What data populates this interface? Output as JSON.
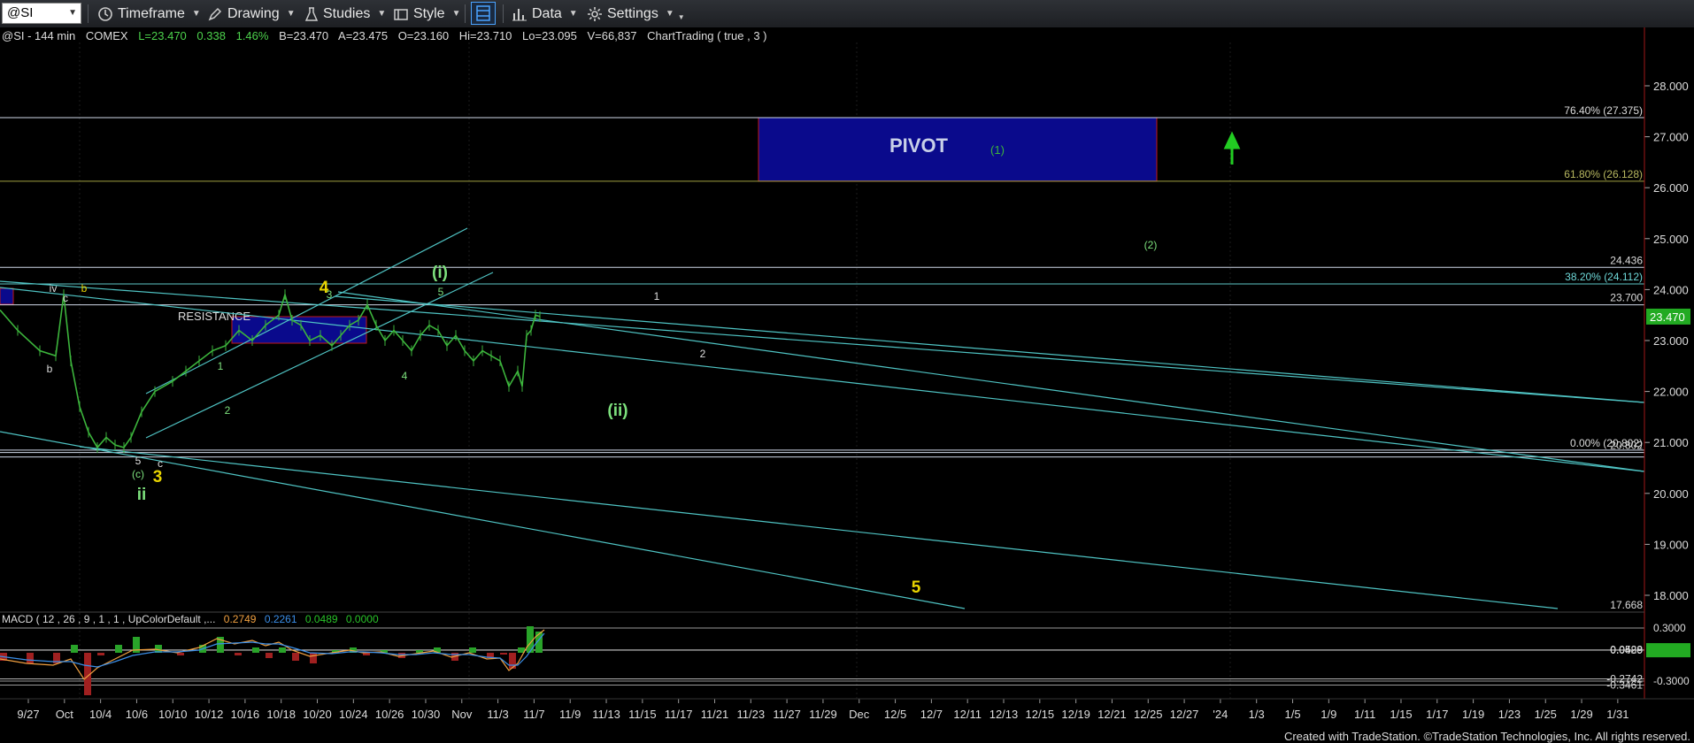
{
  "toolbar": {
    "symbol": "@SI",
    "timeframe": "Timeframe",
    "drawing": "Drawing",
    "studies": "Studies",
    "style": "Style",
    "data": "Data",
    "settings": "Settings"
  },
  "header": {
    "symbol": "@SI - 144 min",
    "exchange": "COMEX",
    "last": "L=23.470",
    "change": "0.338",
    "change_pct": "1.46%",
    "bid": "B=23.470",
    "ask": "A=23.475",
    "open": "O=23.160",
    "high": "Hi=23.710",
    "low": "Lo=23.095",
    "volume": "V=66,837",
    "study": "ChartTrading ( true , 3 )"
  },
  "macd_header": {
    "label": "MACD ( 12 , 26 , 9 , 1 , 1 , UpColorDefault ,...",
    "v1": "0.2749",
    "v2": "0.2261",
    "v3": "0.0489",
    "v4": "0.0000"
  },
  "footer": "Created with TradeStation. ©TradeStation Technologies, Inc. All rights reserved.",
  "colors": {
    "background": "#000000",
    "price_line": "#3cb43c",
    "trendline": "#4fc3c3",
    "wave_yellow": "#e8d400",
    "wave_green": "#7ce07c",
    "pivot_fill": "#0a0a8c",
    "pivot_border": "#c01818",
    "last_price_badge": "#22aa22",
    "macd_line": "#3a8ee8",
    "signal_line": "#f0a040",
    "hist_up": "#29a329",
    "hist_down": "#a02020"
  },
  "chart_data": {
    "type": "line",
    "title": "@SI - 144 min",
    "ylim": [
      17.6,
      28.5
    ],
    "y_ticks": [
      "28.000",
      "27.000",
      "26.000",
      "25.000",
      "24.000",
      "23.000",
      "22.000",
      "21.000",
      "20.000",
      "19.000",
      "18.000"
    ],
    "x_ticks": [
      "9/27",
      "Oct",
      "10/4",
      "10/6",
      "10/10",
      "10/12",
      "10/16",
      "10/18",
      "10/20",
      "10/24",
      "10/26",
      "10/30",
      "Nov",
      "11/3",
      "11/7",
      "11/9",
      "11/13",
      "11/15",
      "11/17",
      "11/21",
      "11/23",
      "11/27",
      "11/29",
      "Dec",
      "12/5",
      "12/7",
      "12/11",
      "12/13",
      "12/15",
      "12/19",
      "12/21",
      "12/25",
      "12/27",
      "'24",
      "1/3",
      "1/5",
      "1/9",
      "1/11",
      "1/15",
      "1/17",
      "1/19",
      "1/23",
      "1/25",
      "1/29",
      "1/31"
    ],
    "price_path": [
      [
        0,
        23.6
      ],
      [
        20,
        23.2
      ],
      [
        45,
        22.8
      ],
      [
        63,
        22.7
      ],
      [
        72,
        23.9
      ],
      [
        80,
        22.6
      ],
      [
        90,
        21.7
      ],
      [
        100,
        21.2
      ],
      [
        110,
        20.9
      ],
      [
        120,
        21.1
      ],
      [
        130,
        20.95
      ],
      [
        140,
        20.9
      ],
      [
        148,
        21.1
      ],
      [
        160,
        21.6
      ],
      [
        175,
        22.0
      ],
      [
        195,
        22.2
      ],
      [
        210,
        22.4
      ],
      [
        225,
        22.6
      ],
      [
        240,
        22.8
      ],
      [
        255,
        22.9
      ],
      [
        270,
        23.2
      ],
      [
        285,
        23.0
      ],
      [
        300,
        23.3
      ],
      [
        315,
        23.5
      ],
      [
        322,
        23.9
      ],
      [
        330,
        23.4
      ],
      [
        340,
        23.3
      ],
      [
        350,
        23.0
      ],
      [
        362,
        23.1
      ],
      [
        375,
        22.9
      ],
      [
        385,
        23.1
      ],
      [
        395,
        23.3
      ],
      [
        405,
        23.4
      ],
      [
        415,
        23.7
      ],
      [
        425,
        23.3
      ],
      [
        435,
        23.0
      ],
      [
        445,
        23.2
      ],
      [
        455,
        23.0
      ],
      [
        465,
        22.8
      ],
      [
        475,
        23.1
      ],
      [
        485,
        23.3
      ],
      [
        495,
        23.2
      ],
      [
        505,
        22.9
      ],
      [
        515,
        23.1
      ],
      [
        525,
        22.8
      ],
      [
        535,
        22.6
      ],
      [
        545,
        22.8
      ],
      [
        555,
        22.7
      ],
      [
        565,
        22.6
      ],
      [
        575,
        22.1
      ],
      [
        585,
        22.4
      ],
      [
        590,
        22.1
      ],
      [
        595,
        23.1
      ],
      [
        600,
        23.2
      ],
      [
        605,
        23.5
      ],
      [
        610,
        23.47
      ]
    ],
    "levels": [
      {
        "label": "76.40% (27.375)",
        "value": 27.375
      },
      {
        "label": "61.80% (26.128)",
        "value": 26.128
      },
      {
        "label": "38.20% (24.112)",
        "value": 24.112
      },
      {
        "label": "24.436",
        "value": 24.436
      },
      {
        "label": "23.700",
        "value": 23.7
      },
      {
        "label": "0.00% (20.802)",
        "value": 20.85
      },
      {
        "label": "20.802",
        "value": 20.802
      },
      {
        "label": "17.668",
        "value": 17.668
      }
    ],
    "last_price": "23.470",
    "zones": [
      {
        "label": "PIVOT",
        "sub": "(1)",
        "y_top": 27.375,
        "y_bottom": 26.128
      },
      {
        "label": "RESISTANCE",
        "y_top": 23.3,
        "y_bottom": 23.05
      }
    ],
    "wave_labels": [
      {
        "text": "iv",
        "value": 23.95,
        "color": "white"
      },
      {
        "text": "b",
        "value": 24.0,
        "color": "yellow"
      },
      {
        "text": "c",
        "value": 23.6,
        "color": "white"
      },
      {
        "text": "b",
        "value": 22.0,
        "color": "white"
      },
      {
        "text": "5",
        "value": 20.8,
        "color": "white"
      },
      {
        "text": "c",
        "value": 20.75,
        "color": "white"
      },
      {
        "text": "(c)",
        "value": 20.6,
        "color": "green"
      },
      {
        "text": "3",
        "value": 20.45,
        "color": "yellow"
      },
      {
        "text": "ii",
        "value": 20.1,
        "color": "green"
      },
      {
        "text": "1",
        "value": 22.3,
        "color": "green"
      },
      {
        "text": "2",
        "value": 21.85,
        "color": "green"
      },
      {
        "text": "3",
        "value": 23.85,
        "color": "green"
      },
      {
        "text": "4",
        "value": 24.1,
        "color": "yellow"
      },
      {
        "text": "4",
        "value": 22.15,
        "color": "green"
      },
      {
        "text": "5",
        "value": 23.9,
        "color": "green"
      },
      {
        "text": "(i)",
        "value": 24.35,
        "color": "green"
      },
      {
        "text": "(ii)",
        "value": 21.75,
        "color": "green"
      },
      {
        "text": "1",
        "value": 23.95,
        "color": "white"
      },
      {
        "text": "2",
        "value": 22.75,
        "color": "white"
      },
      {
        "text": "(2)",
        "value": 24.95,
        "color": "green"
      },
      {
        "text": "5",
        "value": 18.1,
        "color": "yellow"
      }
    ],
    "macd": {
      "ylim": [
        -0.38,
        0.4
      ],
      "y_ticks": [
        "0.3000",
        "0.0528",
        "0.0489",
        "-0.2742",
        "-0.3461",
        "-0.3000"
      ],
      "macd_line": [
        [
          0,
          -0.05
        ],
        [
          30,
          -0.1
        ],
        [
          60,
          -0.12
        ],
        [
          80,
          -0.05
        ],
        [
          95,
          -0.28
        ],
        [
          110,
          -0.15
        ],
        [
          130,
          -0.05
        ],
        [
          150,
          0.05
        ],
        [
          175,
          0.06
        ],
        [
          200,
          0.02
        ],
        [
          225,
          0.08
        ],
        [
          245,
          0.18
        ],
        [
          265,
          0.12
        ],
        [
          285,
          0.16
        ],
        [
          300,
          0.1
        ],
        [
          315,
          0.14
        ],
        [
          330,
          0.05
        ],
        [
          350,
          -0.02
        ],
        [
          375,
          0.02
        ],
        [
          395,
          0.05
        ],
        [
          410,
          0.02
        ],
        [
          430,
          0.03
        ],
        [
          450,
          -0.02
        ],
        [
          470,
          0.01
        ],
        [
          490,
          0.04
        ],
        [
          510,
          -0.03
        ],
        [
          530,
          0.02
        ],
        [
          550,
          -0.05
        ],
        [
          565,
          -0.04
        ],
        [
          575,
          -0.18
        ],
        [
          585,
          -0.1
        ],
        [
          595,
          0.08
        ],
        [
          605,
          0.2
        ],
        [
          615,
          0.28
        ]
      ],
      "signal_line": [
        [
          0,
          -0.02
        ],
        [
          30,
          -0.06
        ],
        [
          60,
          -0.08
        ],
        [
          80,
          -0.08
        ],
        [
          95,
          -0.12
        ],
        [
          110,
          -0.14
        ],
        [
          130,
          -0.08
        ],
        [
          150,
          -0.01
        ],
        [
          175,
          0.03
        ],
        [
          200,
          0.03
        ],
        [
          225,
          0.05
        ],
        [
          245,
          0.12
        ],
        [
          265,
          0.13
        ],
        [
          285,
          0.14
        ],
        [
          300,
          0.12
        ],
        [
          315,
          0.12
        ],
        [
          330,
          0.08
        ],
        [
          350,
          0.02
        ],
        [
          375,
          0.01
        ],
        [
          395,
          0.03
        ],
        [
          410,
          0.03
        ],
        [
          430,
          0.02
        ],
        [
          450,
          0.0
        ],
        [
          470,
          0.0
        ],
        [
          490,
          0.02
        ],
        [
          510,
          0.0
        ],
        [
          530,
          0.0
        ],
        [
          550,
          -0.03
        ],
        [
          565,
          -0.04
        ],
        [
          575,
          -0.12
        ],
        [
          585,
          -0.12
        ],
        [
          595,
          -0.02
        ],
        [
          605,
          0.12
        ],
        [
          615,
          0.24
        ]
      ]
    }
  }
}
